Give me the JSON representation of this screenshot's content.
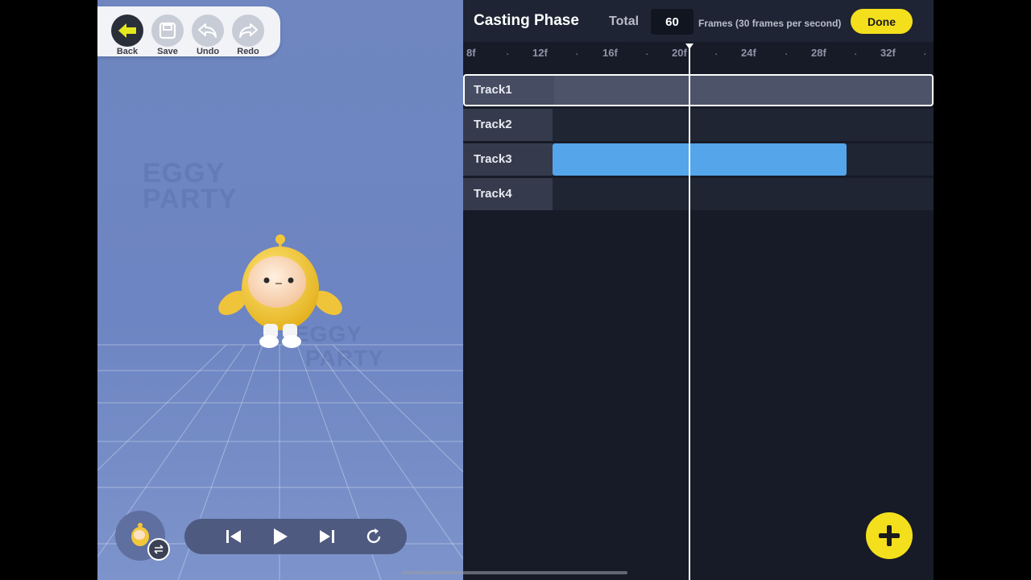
{
  "toolbar": {
    "back_label": "Back",
    "save_label": "Save",
    "undo_label": "Undo",
    "redo_label": "Redo"
  },
  "viewport": {
    "background_color": "#6f86c0",
    "watermark_texts": [
      "EGGY",
      "PARTY",
      "EGGY",
      "PARTY"
    ]
  },
  "playback": {
    "buttons": [
      "step-back-icon",
      "play-icon",
      "step-forward-icon",
      "loop-icon"
    ]
  },
  "timeline": {
    "title": "Casting Phase",
    "total_label": "Total",
    "total_frames": "60",
    "frames_unit_label": "Frames (30 frames per second)",
    "done_label": "Done",
    "ruler_ticks": [
      "8f",
      "12f",
      "16f",
      "20f",
      "24f",
      "28f",
      "32f"
    ],
    "tracks": [
      {
        "label": "Track1",
        "selected": true
      },
      {
        "label": "Track2",
        "selected": false
      },
      {
        "label": "Track3",
        "selected": false
      },
      {
        "label": "Track4",
        "selected": false
      }
    ],
    "clip_color": "#55a5ea",
    "accent_color": "#f4df1d"
  }
}
